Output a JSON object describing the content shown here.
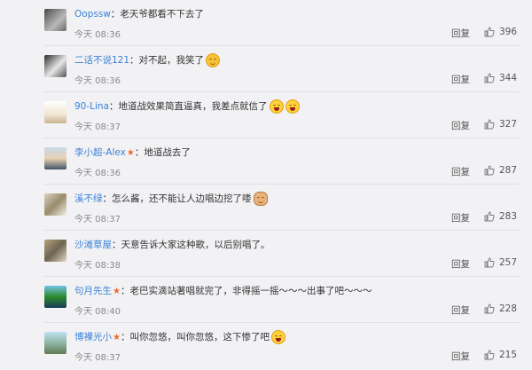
{
  "comments": [
    {
      "user": "Oopssw",
      "vip": false,
      "text": "老天爷都看不下去了",
      "emoji": "",
      "time": "今天 08:36",
      "reply": "回复",
      "likes": "396"
    },
    {
      "user": "二话不说121",
      "vip": false,
      "text": "对不起，我笑了",
      "emoji": "shy-smile",
      "time": "今天 08:36",
      "reply": "回复",
      "likes": "344"
    },
    {
      "user": "90-Lina",
      "vip": false,
      "text": "地道战效果简直逼真，我差点就信了",
      "emoji": "laugh-tears x2",
      "time": "今天 08:37",
      "reply": "回复",
      "likes": "327"
    },
    {
      "user": "李小超-Alex",
      "vip": true,
      "text": "地道战去了",
      "emoji": "",
      "time": "今天 08:36",
      "reply": "回复",
      "likes": "287"
    },
    {
      "user": "溪不绿",
      "vip": false,
      "text": "怎么酱，还不能让人边唱边挖了喽",
      "emoji": "doge",
      "time": "今天 08:37",
      "reply": "回复",
      "likes": "283"
    },
    {
      "user": "沙滩草屋",
      "vip": false,
      "text": "天意告诉大家这种歌，以后别唱了。",
      "emoji": "",
      "time": "今天 08:38",
      "reply": "回复",
      "likes": "257"
    },
    {
      "user": "句月先生",
      "vip": true,
      "text": "老巴实滴站著唱就完了，非得摇一摇～～～出事了吧～～～",
      "emoji": "",
      "time": "今天 08:40",
      "reply": "回复",
      "likes": "228"
    },
    {
      "user": "博裸光小",
      "vip": true,
      "text": "叫你忽悠，叫你忽悠，这下惨了吧",
      "emoji": "laugh-cry",
      "time": "今天 08:37",
      "reply": "回复",
      "likes": "215"
    }
  ],
  "icons": {
    "like": "thumbs-up-icon",
    "vip": "star-icon"
  },
  "colors": {
    "username": "#3b82d6",
    "star": "#ef6a2b",
    "text": "#333333",
    "time": "#8a8a8a",
    "background": "#f2f2f5"
  }
}
